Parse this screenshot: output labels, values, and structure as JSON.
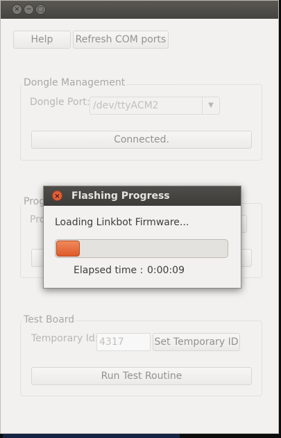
{
  "window": {
    "buttons": {
      "close": "×",
      "minimize": "−",
      "maximize": "□"
    }
  },
  "toolbar": {
    "help_label": "Help",
    "refresh_label": "Refresh COM ports"
  },
  "dongle": {
    "group_title": "Dongle Management",
    "port_label": "Dongle Port:",
    "port_value": "/dev/ttyACM2",
    "status_button": "Connected."
  },
  "program": {
    "group_title_partial": "Prog",
    "row_label_partial": "Pro"
  },
  "test_board": {
    "group_title": "Test Board",
    "temp_id_label": "Temporary Id:",
    "temp_id_value": "4317",
    "set_button": "Set Temporary ID",
    "run_button": "Run Test Routine"
  },
  "dialog": {
    "title": "Flashing Progress",
    "message": "Loading Linkbot Firmware...",
    "progress": 0.14,
    "elapsed_label": "Elapsed time :",
    "elapsed_value": "0:00:09",
    "close_glyph": "×"
  },
  "colors": {
    "accent": "#dd5a2a",
    "titlebar": "#45433f",
    "window_bg": "#f2f1f0"
  }
}
